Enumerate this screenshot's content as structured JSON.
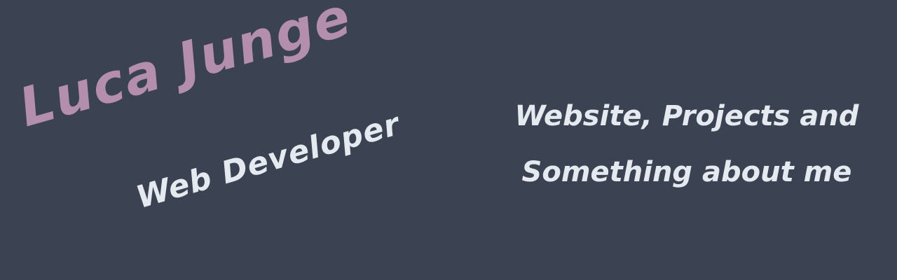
{
  "banner": {
    "name": "Luca Junge",
    "role": "Web Developer",
    "tagline_line1": "Website, Projects and",
    "tagline_line2": "Something about me"
  },
  "colors": {
    "background": "#3b4252",
    "name": "#b48ead",
    "text": "#e5e9f0"
  }
}
